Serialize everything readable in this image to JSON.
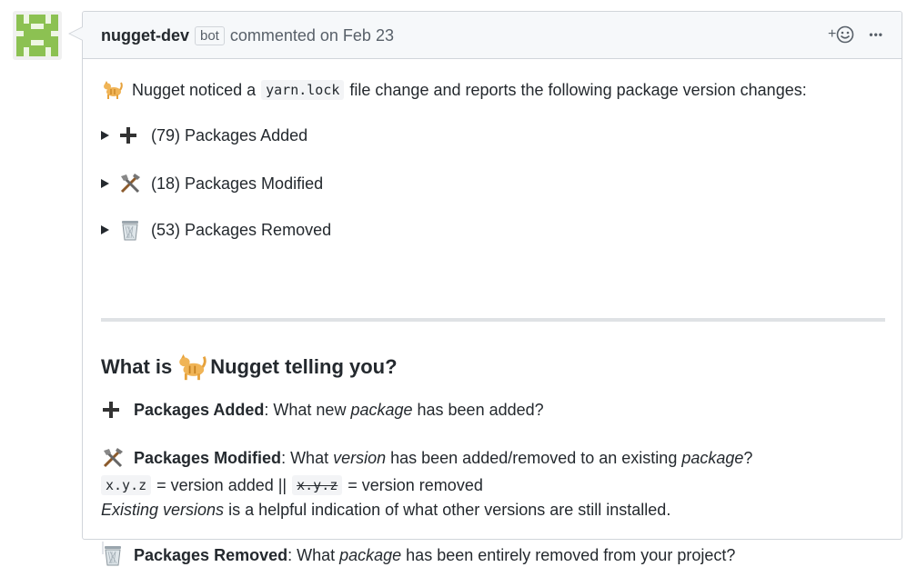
{
  "comment": {
    "author": "nugget-dev",
    "badge": "bot",
    "meta": "commented on Feb 23",
    "react_label": "+",
    "more_label": "•••"
  },
  "intro": {
    "text_before": "Nugget noticed a",
    "code": "yarn.lock",
    "text_after": "file change and reports the following package version changes:"
  },
  "summaries": [
    {
      "label": "(79) Packages Added",
      "icon": "plus-icon"
    },
    {
      "label": "(18) Packages Modified",
      "icon": "tools-icon"
    },
    {
      "label": "(53) Packages Removed",
      "icon": "wastebasket-icon"
    }
  ],
  "explainer": {
    "heading_before": "What is",
    "heading_after": "Nugget telling you?",
    "added": {
      "bold": "Packages Added",
      "t1": ": What new ",
      "em1": "package",
      "t2": " has been added?"
    },
    "modified": {
      "bold": "Packages Modified",
      "t1": ": What ",
      "em1": "version",
      "t2": " has been added/removed to an existing ",
      "em2": "package",
      "t3": "?"
    },
    "versions": {
      "code_added": "x.y.z",
      "t1": "= version added ||",
      "code_removed": "x.y.z",
      "t2": "= version removed"
    },
    "existing": {
      "em": "Existing versions",
      "t": " is a helpful indication of what other versions are still installed."
    },
    "removed": {
      "bold": "Packages Removed",
      "t1": ": What ",
      "em1": "package",
      "t2": " has been entirely removed from your project?"
    }
  },
  "colors": {
    "avatar": "#7ed321",
    "border": "#d1d5da",
    "header_bg": "#f6f8fa"
  }
}
